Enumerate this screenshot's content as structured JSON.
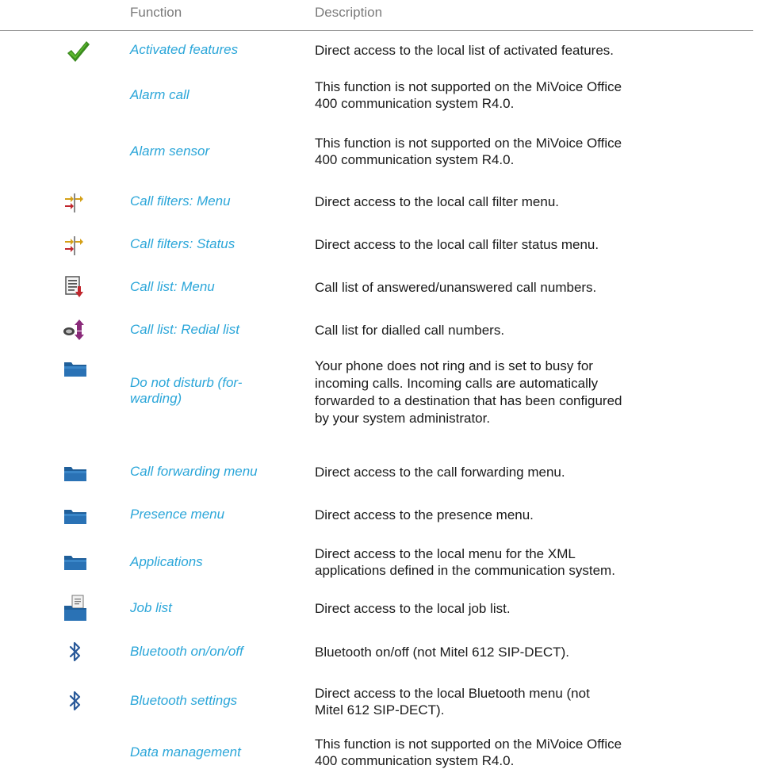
{
  "header": {
    "function_label": "Function",
    "description_label": "Description"
  },
  "rows": [
    {
      "icon": "checkmark-icon",
      "function": "Activated features",
      "description": "Direct access to the local list of activated features."
    },
    {
      "icon": "",
      "function": "Alarm call",
      "description": "This function is not supported on the MiVoice Office 400 communication system R4.0."
    },
    {
      "icon": "",
      "function": "Alarm sensor",
      "description": "This function is not supported on the MiVoice Office 400 communication system R4.0."
    },
    {
      "icon": "call-filter-icon",
      "function": "Call filters: Menu",
      "description": "Direct access to the local call filter menu."
    },
    {
      "icon": "call-filter-icon",
      "function": "Call filters: Status",
      "description": "Direct access to the local call filter status menu."
    },
    {
      "icon": "call-list-icon",
      "function": "Call list: Menu",
      "description": "Call list of answered/unanswered call numbers."
    },
    {
      "icon": "redial-list-icon",
      "function": "Call list: Redial list",
      "description": "Call list for dialled call numbers."
    },
    {
      "icon": "folder-icon",
      "function": "Do not disturb (for-warding)",
      "function_line1": "Do not disturb (for-",
      "function_line2": "warding)",
      "description": "Your phone does not ring and is set to busy for incoming calls. Incoming calls are automatically forwarded to a destination that has been configured by your system administrator."
    },
    {
      "icon": "folder-icon",
      "function": "Call forwarding menu",
      "description": "Direct access to the call forwarding menu."
    },
    {
      "icon": "folder-icon",
      "function": "Presence menu",
      "description": "Direct access to the presence menu."
    },
    {
      "icon": "folder-icon",
      "function": "Applications",
      "description": "Direct access to the local menu for the XML applications defined in the communication system."
    },
    {
      "icon": "job-list-folder-icon",
      "function": "Job list",
      "description": "Direct access to the local job list."
    },
    {
      "icon": "bluetooth-icon",
      "function": "Bluetooth on/on/off",
      "description": "Bluetooth on/off (not Mitel 612 SIP-DECT)."
    },
    {
      "icon": "bluetooth-icon",
      "function": "Bluetooth settings",
      "description_line1": "Direct access to the local Bluetooth menu (not",
      "description_line2": "Mitel 612 SIP-DECT)."
    },
    {
      "icon": "",
      "function": "Data management",
      "description": "This function is not supported on the MiVoice Office 400 communication system R4.0."
    }
  ],
  "colors": {
    "function_link": "#2ba6d9",
    "checkmark": "#3a8a1e",
    "folder": "#1f5f9a",
    "bluetooth": "#2a5a9a",
    "filter_red": "#c0262d",
    "filter_gold": "#d4a017",
    "redial_purple": "#8a2a7a"
  }
}
